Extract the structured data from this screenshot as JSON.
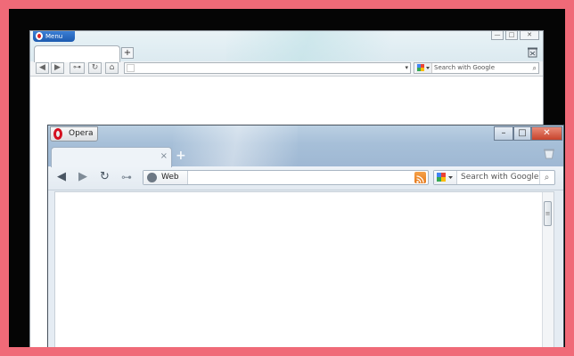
{
  "back_window": {
    "menu_label": "Menu",
    "new_tab_symbol": "+",
    "window_controls": [
      "—",
      "□",
      "✕"
    ],
    "toolbar_buttons": [
      "◀",
      "▶",
      "⊶",
      "↻",
      "⌂"
    ],
    "address_dropdown": "▾",
    "search_placeholder": "Search with Google",
    "search_icon": "⌕"
  },
  "front_window": {
    "title": "Opera",
    "tab_close": "×",
    "new_tab_symbol": "+",
    "window_controls": [
      "–",
      "□",
      "✕"
    ],
    "nav": {
      "back": "◀",
      "forward": "▶",
      "reload": "↻",
      "key": "⊶"
    },
    "address_label": "Web",
    "address_value": "",
    "search_placeholder": "Search with Google",
    "search_icon": "⌕",
    "scroll_grip": "≡"
  },
  "colors": {
    "frame_border": "#f06a78",
    "opera_red": "#d4101f",
    "rss_orange": "#e5781a"
  }
}
